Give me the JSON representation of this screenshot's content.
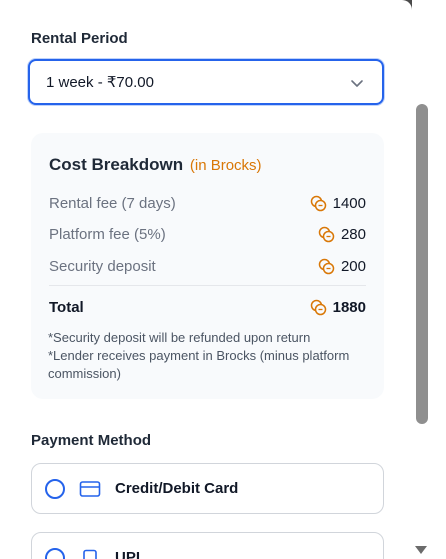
{
  "rental": {
    "label": "Rental Period",
    "selected": "1 week - ₹70.00"
  },
  "breakdown": {
    "title": "Cost Breakdown",
    "unit": "(in Brocks)",
    "rows": [
      {
        "label": "Rental fee (7 days)",
        "value": "1400"
      },
      {
        "label": "Platform fee (5%)",
        "value": "280"
      },
      {
        "label": "Security deposit",
        "value": "200"
      }
    ],
    "total_label": "Total",
    "total_value": "1880",
    "notes": [
      "*Security deposit will be refunded upon return",
      "*Lender receives payment in Brocks (minus platform commission)"
    ]
  },
  "payment": {
    "label": "Payment Method",
    "options": [
      {
        "label": "Credit/Debit Card",
        "icon": "credit-card-icon"
      },
      {
        "label": "UPI",
        "icon": "phone-icon"
      }
    ]
  },
  "colors": {
    "accent": "#2563eb",
    "brock": "#d97706"
  }
}
